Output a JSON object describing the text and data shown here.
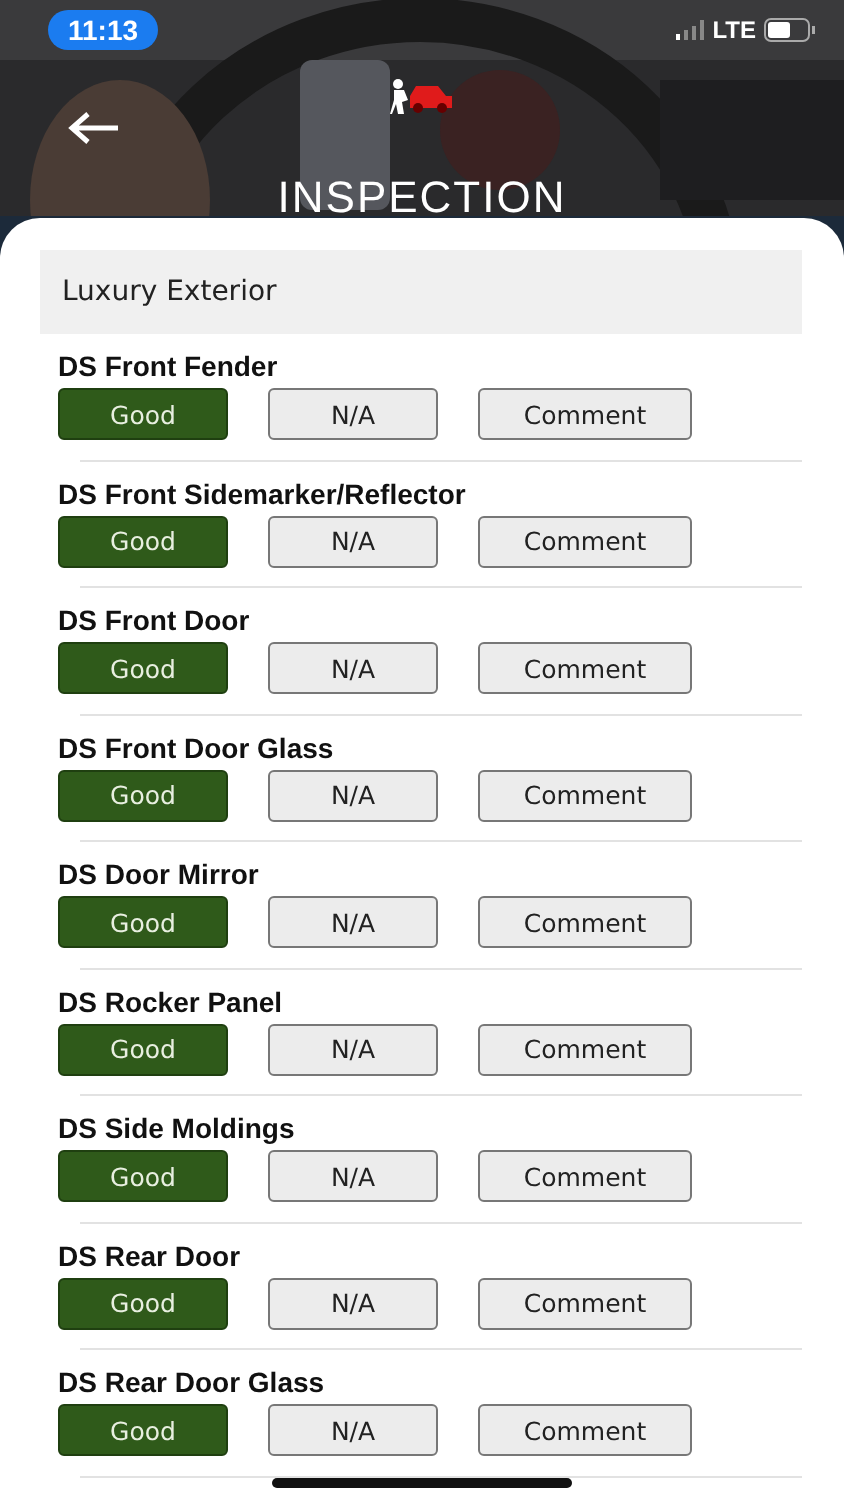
{
  "status_bar": {
    "time": "11:13",
    "network": "LTE"
  },
  "header": {
    "title": "INSPECTION"
  },
  "section": {
    "title": "Luxury Exterior"
  },
  "items": [
    {
      "title": "DS Front Fender",
      "buttons": [
        {
          "label": "Good",
          "selected": true
        },
        {
          "label": "N/A",
          "selected": false
        },
        {
          "label": "Comment",
          "selected": false
        }
      ]
    },
    {
      "title": "DS Front Sidemarker/Reflector",
      "buttons": [
        {
          "label": "Good",
          "selected": true
        },
        {
          "label": "N/A",
          "selected": false
        },
        {
          "label": "Comment",
          "selected": false
        }
      ]
    },
    {
      "title": "DS Front Door",
      "buttons": [
        {
          "label": "Good",
          "selected": true
        },
        {
          "label": "N/A",
          "selected": false
        },
        {
          "label": "Comment",
          "selected": false
        }
      ]
    },
    {
      "title": "DS Front Door Glass",
      "buttons": [
        {
          "label": "Good",
          "selected": true
        },
        {
          "label": "N/A",
          "selected": false
        },
        {
          "label": "Comment",
          "selected": false
        }
      ]
    },
    {
      "title": "DS Door Mirror",
      "buttons": [
        {
          "label": "Good",
          "selected": true
        },
        {
          "label": "N/A",
          "selected": false
        },
        {
          "label": "Comment",
          "selected": false
        }
      ]
    },
    {
      "title": "DS Rocker Panel",
      "buttons": [
        {
          "label": "Good",
          "selected": true
        },
        {
          "label": "N/A",
          "selected": false
        },
        {
          "label": "Comment",
          "selected": false
        }
      ]
    },
    {
      "title": "DS Side Moldings",
      "buttons": [
        {
          "label": "Good",
          "selected": true
        },
        {
          "label": "N/A",
          "selected": false
        },
        {
          "label": "Comment",
          "selected": false
        }
      ]
    },
    {
      "title": "DS Rear Door",
      "buttons": [
        {
          "label": "Good",
          "selected": true
        },
        {
          "label": "N/A",
          "selected": false
        },
        {
          "label": "Comment",
          "selected": false
        }
      ]
    },
    {
      "title": "DS Rear Door Glass",
      "buttons": [
        {
          "label": "Good",
          "selected": true
        },
        {
          "label": "N/A",
          "selected": false
        },
        {
          "label": "Comment",
          "selected": false
        }
      ]
    }
  ]
}
